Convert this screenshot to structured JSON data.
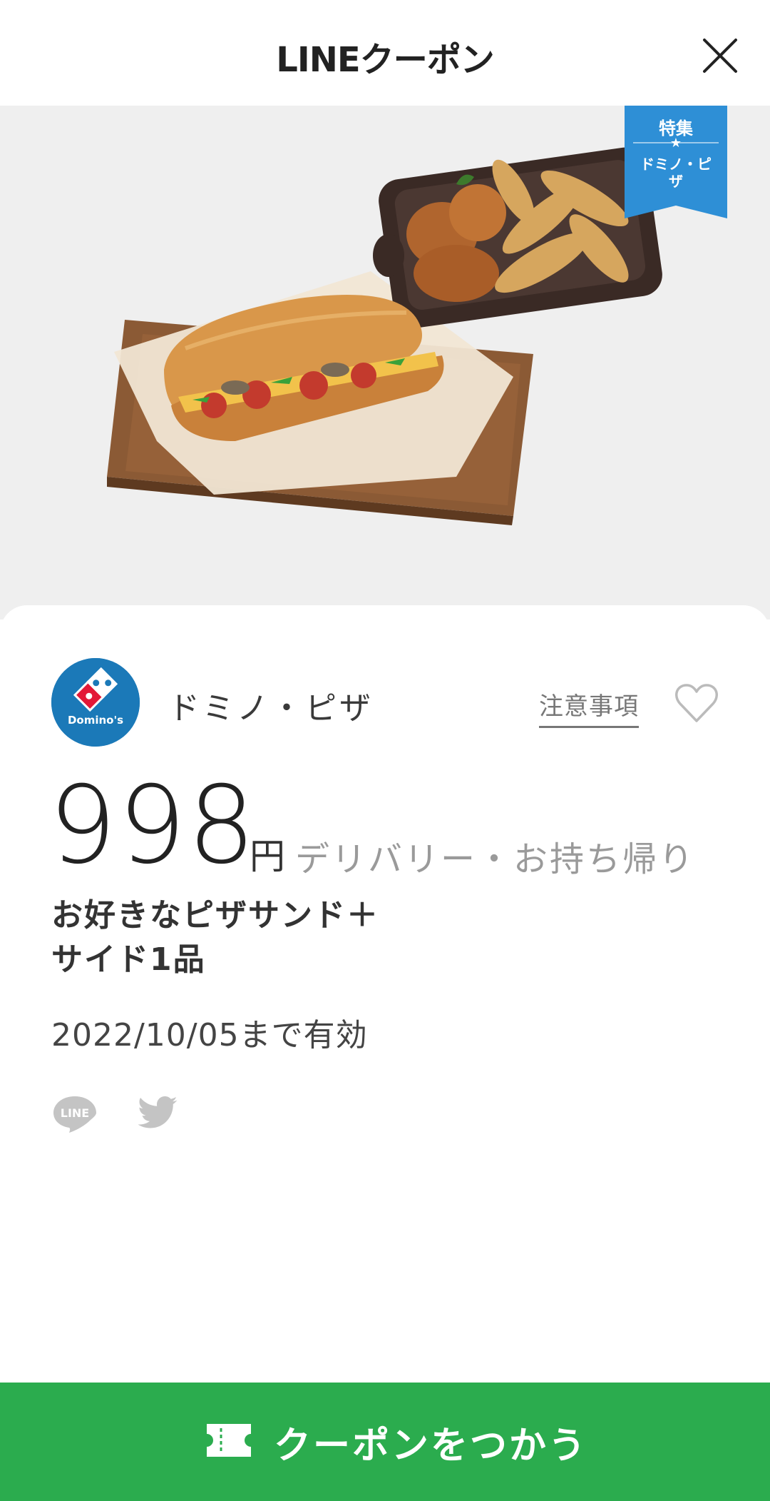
{
  "header": {
    "title": "LINEクーポン"
  },
  "hero": {
    "ribbon_title": "特集",
    "ribbon_star": "★",
    "ribbon_sub": "ドミノ・ピザ"
  },
  "store": {
    "logo_text": "Domino's",
    "name": "ドミノ・ピザ",
    "notes_label": "注意事項"
  },
  "coupon": {
    "price": "998",
    "currency": "円",
    "delivery": "デリバリー・お持ち帰り",
    "description_line1": "お好きなピザサンド＋",
    "description_line2": "サイド1品",
    "valid_until": "2022/10/05まで有効"
  },
  "share": {
    "line_icon_text": "LINE"
  },
  "cta": {
    "label": "クーポンをつかう"
  },
  "colors": {
    "accent_green": "#2bac4e",
    "ribbon_blue": "#2e8fd6",
    "dominos_blue": "#1b79b8",
    "dominos_red": "#e31837"
  }
}
